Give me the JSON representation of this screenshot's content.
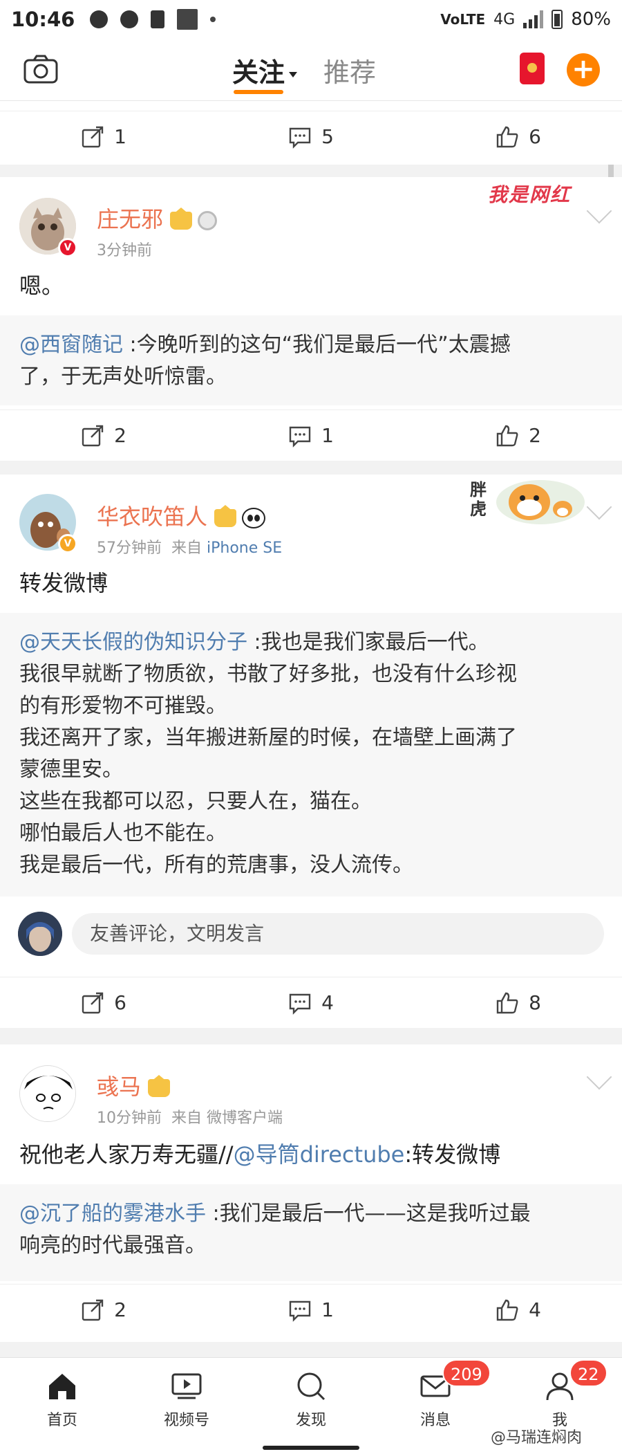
{
  "status_bar": {
    "time": "10:46",
    "network": "4G",
    "battery": "80%",
    "volte": "VoLTE"
  },
  "top_nav": {
    "tab_follow": "关注",
    "tab_recommend": "推荐"
  },
  "feed": {
    "card0": {
      "actions": {
        "repost": "1",
        "comment": "5",
        "like": "6"
      }
    },
    "card1": {
      "username": "庄无邪",
      "time": "3分钟前",
      "text": "嗯。",
      "sticker": "我是网红",
      "repost_user": "@西窗随记",
      "repost_text_1": " :今晚听到的这句“我们是最后一代”太震撼",
      "repost_text_2": "了，于无声处听惊雷。",
      "actions": {
        "repost": "2",
        "comment": "1",
        "like": "2"
      }
    },
    "card2": {
      "username": "华衣吹笛人",
      "time": "57分钟前",
      "from_label": "来自",
      "source": "iPhone SE",
      "text": "转发微博",
      "sticker": "胖虎",
      "repost_user": "@天天长假的伪知识分子",
      "repost_lines": [
        " :我也是我们家最后一代。",
        "我很早就断了物质欲，书散了好多批，也没有什么珍视",
        "的有形爱物不可摧毁。",
        "我还离开了家，当年搬进新屋的时候，在墙壁上画满了",
        "蒙德里安。",
        "这些在我都可以忍，只要人在，猫在。",
        "哪怕最后人也不能在。",
        "我是最后一代，所有的荒唐事，没人流传。"
      ],
      "comment_placeholder": "友善评论，文明发言",
      "actions": {
        "repost": "6",
        "comment": "4",
        "like": "8"
      }
    },
    "card3": {
      "username": "彧马",
      "time": "10分钟前",
      "from_label": "来自",
      "source": "微博客户端",
      "text_prefix": "祝他老人家万寿无疆//",
      "text_mention": "@导筒directube",
      "text_suffix": ":转发微博",
      "repost_user": "@沉了船的雾港水手",
      "repost_text_1": " :我们是最后一代——这是我听过最",
      "repost_text_2": "响亮的时代最强音。",
      "actions": {
        "repost": "2",
        "comment": "1",
        "like": "4"
      }
    }
  },
  "bottom_nav": {
    "home": "首页",
    "video": "视频号",
    "discover": "发现",
    "messages": "消息",
    "messages_badge": "209",
    "me": "我",
    "me_badge": "22"
  },
  "watermark": "@马瑞连焖肉",
  "colors": {
    "accent": "#ff8200",
    "username": "#eb7350",
    "mention": "#507daf",
    "badge": "#f2463b"
  }
}
